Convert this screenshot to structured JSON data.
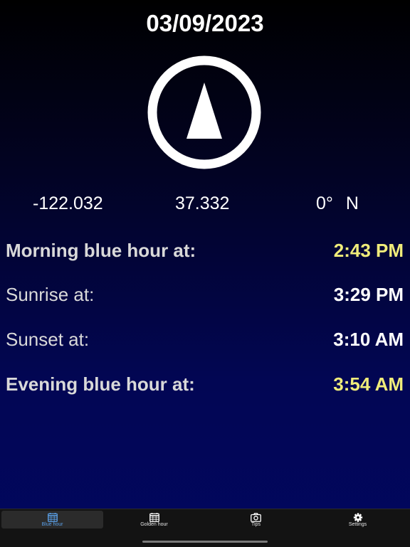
{
  "date": "03/09/2023",
  "location": {
    "longitude": "-122.032",
    "latitude": "37.332",
    "heading_degrees": "0°",
    "heading_direction": "N"
  },
  "times": [
    {
      "label": "Morning blue hour at:",
      "value": "2:43 PM",
      "bold_label": true,
      "value_color": "#f0ec7a"
    },
    {
      "label": "Sunrise at:",
      "value": "3:29 PM",
      "bold_label": false,
      "value_color": "#ffffff"
    },
    {
      "label": "Sunset at:",
      "value": "3:10 AM",
      "bold_label": false,
      "value_color": "#ffffff"
    },
    {
      "label": "Evening blue hour at:",
      "value": "3:54 AM",
      "bold_label": true,
      "value_color": "#f0ec7a"
    }
  ],
  "tabs": [
    {
      "label": "Blue hour",
      "icon": "calendar-icon",
      "selected": true
    },
    {
      "label": "Golden hour",
      "icon": "calendar-icon",
      "selected": false
    },
    {
      "label": "Tips",
      "icon": "camera-icon",
      "selected": false
    },
    {
      "label": "Settings",
      "icon": "gear-icon",
      "selected": false
    }
  ],
  "colors": {
    "background_top": "#000000",
    "background_bottom": "#01075e",
    "highlight": "#f0ec7a",
    "selected_tab": "#5a9fe6"
  }
}
